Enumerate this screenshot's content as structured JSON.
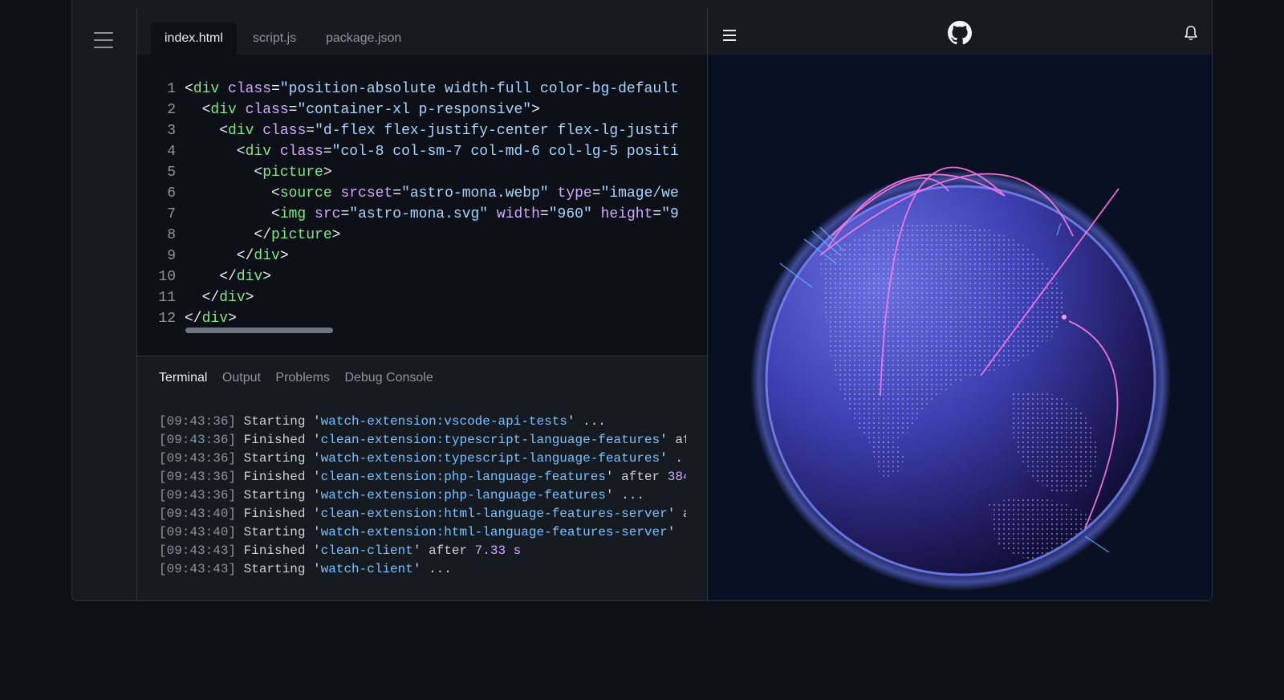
{
  "editor": {
    "tabs": [
      {
        "label": "index.html",
        "active": true
      },
      {
        "label": "script.js",
        "active": false
      },
      {
        "label": "package.json",
        "active": false
      }
    ],
    "lines": [
      {
        "n": "1",
        "parts": [
          [
            "pu",
            "<"
          ],
          [
            "tg",
            "div"
          ],
          [
            "pu",
            " "
          ],
          [
            "at",
            "class"
          ],
          [
            "pu",
            "="
          ],
          [
            "st",
            "\"position-absolute width-full color-bg-default"
          ]
        ]
      },
      {
        "n": "2",
        "parts": [
          [
            "pu",
            "  <"
          ],
          [
            "tg",
            "div"
          ],
          [
            "pu",
            " "
          ],
          [
            "at",
            "class"
          ],
          [
            "pu",
            "="
          ],
          [
            "st",
            "\"container-xl p-responsive\""
          ],
          [
            "pu",
            ">"
          ]
        ]
      },
      {
        "n": "3",
        "parts": [
          [
            "pu",
            "    <"
          ],
          [
            "tg",
            "div"
          ],
          [
            "pu",
            " "
          ],
          [
            "at",
            "class"
          ],
          [
            "pu",
            "="
          ],
          [
            "st",
            "\"d-flex flex-justify-center flex-lg-justif"
          ]
        ]
      },
      {
        "n": "4",
        "parts": [
          [
            "pu",
            "      <"
          ],
          [
            "tg",
            "div"
          ],
          [
            "pu",
            " "
          ],
          [
            "at",
            "class"
          ],
          [
            "pu",
            "="
          ],
          [
            "st",
            "\"col-8 col-sm-7 col-md-6 col-lg-5 positi"
          ]
        ]
      },
      {
        "n": "5",
        "parts": [
          [
            "pu",
            "        <"
          ],
          [
            "tg",
            "picture"
          ],
          [
            "pu",
            ">"
          ]
        ]
      },
      {
        "n": "6",
        "parts": [
          [
            "pu",
            "          <"
          ],
          [
            "tg",
            "source"
          ],
          [
            "pu",
            " "
          ],
          [
            "at",
            "srcset"
          ],
          [
            "pu",
            "="
          ],
          [
            "st",
            "\"astro-mona.webp\""
          ],
          [
            "pu",
            " "
          ],
          [
            "at",
            "type"
          ],
          [
            "pu",
            "="
          ],
          [
            "st",
            "\"image/we"
          ]
        ]
      },
      {
        "n": "7",
        "parts": [
          [
            "pu",
            "          <"
          ],
          [
            "tg",
            "img"
          ],
          [
            "pu",
            " "
          ],
          [
            "at",
            "src"
          ],
          [
            "pu",
            "="
          ],
          [
            "st",
            "\"astro-mona.svg\""
          ],
          [
            "pu",
            " "
          ],
          [
            "at",
            "width"
          ],
          [
            "pu",
            "="
          ],
          [
            "st",
            "\"960\""
          ],
          [
            "pu",
            " "
          ],
          [
            "at",
            "height"
          ],
          [
            "pu",
            "="
          ],
          [
            "st",
            "\"9"
          ]
        ]
      },
      {
        "n": "8",
        "parts": [
          [
            "pu",
            "        </"
          ],
          [
            "tg",
            "picture"
          ],
          [
            "pu",
            ">"
          ]
        ]
      },
      {
        "n": "9",
        "parts": [
          [
            "pu",
            "      </"
          ],
          [
            "tg",
            "div"
          ],
          [
            "pu",
            ">"
          ]
        ]
      },
      {
        "n": "10",
        "parts": [
          [
            "pu",
            "    </"
          ],
          [
            "tg",
            "div"
          ],
          [
            "pu",
            ">"
          ]
        ]
      },
      {
        "n": "11",
        "parts": [
          [
            "pu",
            "  </"
          ],
          [
            "tg",
            "div"
          ],
          [
            "pu",
            ">"
          ]
        ]
      },
      {
        "n": "12",
        "parts": [
          [
            "pu",
            "</"
          ],
          [
            "tg",
            "div"
          ],
          [
            "pu",
            ">"
          ]
        ]
      }
    ]
  },
  "terminal": {
    "tabs": [
      {
        "label": "Terminal",
        "active": true
      },
      {
        "label": "Output",
        "active": false
      },
      {
        "label": "Problems",
        "active": false
      },
      {
        "label": "Debug Console",
        "active": false
      }
    ],
    "lines": [
      {
        "ts": "[09:43:36]",
        "verb": " Starting '",
        "task": "watch-extension:vscode-api-tests",
        "rest": "' ...",
        "num": ""
      },
      {
        "ts": "[09:43:36]",
        "verb": " Finished '",
        "task": "clean-extension:typescript-language-features",
        "rest": "' af",
        "num": ""
      },
      {
        "ts": "[09:43:36]",
        "verb": " Starting '",
        "task": "watch-extension:typescript-language-features",
        "rest": "' .",
        "num": ""
      },
      {
        "ts": "[09:43:36]",
        "verb": " Finished '",
        "task": "clean-extension:php-language-features",
        "rest": "' after ",
        "num": "384"
      },
      {
        "ts": "[09:43:36]",
        "verb": " Starting '",
        "task": "watch-extension:php-language-features",
        "rest": "' ...",
        "num": ""
      },
      {
        "ts": "[09:43:40]",
        "verb": " Finished '",
        "task": "clean-extension:html-language-features-server",
        "rest": "' a",
        "num": ""
      },
      {
        "ts": "[09:43:40]",
        "verb": " Starting '",
        "task": "watch-extension:html-language-features-server",
        "rest": "'",
        "num": ""
      },
      {
        "ts": "[09:43:43]",
        "verb": " Finished '",
        "task": "clean-client",
        "rest": "' after ",
        "num": "7.33 s"
      },
      {
        "ts": "[09:43:43]",
        "verb": " Starting '",
        "task": "watch-client",
        "rest": "' ...",
        "num": ""
      }
    ]
  },
  "preview": {
    "icons": {
      "menu": "hamburger-menu-icon",
      "logo": "github-logo-icon",
      "notifications": "bell-icon"
    },
    "colors": {
      "arc": "#ff7be5",
      "globe": "#4a57d8",
      "glow": "#6f7dff"
    }
  }
}
